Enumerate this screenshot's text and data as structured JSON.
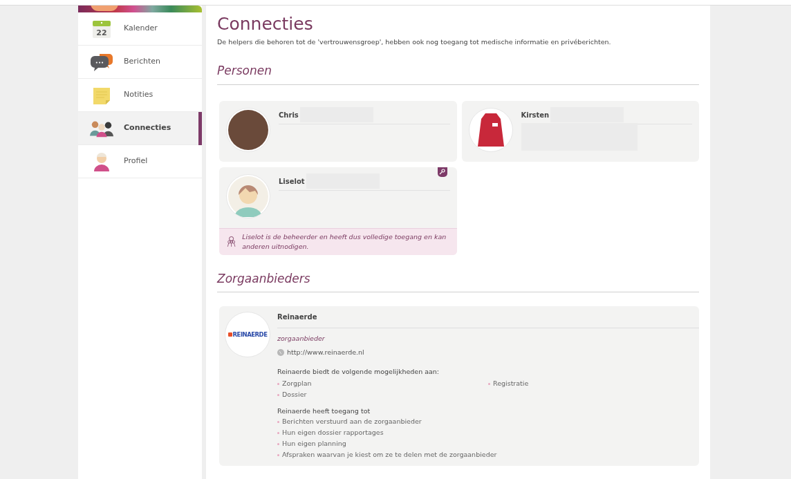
{
  "sidebar": {
    "items": [
      {
        "label": "Kalender",
        "kind": "calendar",
        "icon_text": "22",
        "selected": false
      },
      {
        "label": "Berichten",
        "kind": "chat",
        "icon_text": "•••",
        "selected": false
      },
      {
        "label": "Notities",
        "kind": "note",
        "selected": false
      },
      {
        "label": "Connecties",
        "kind": "people",
        "selected": true
      },
      {
        "label": "Profiel",
        "kind": "person",
        "selected": false
      }
    ]
  },
  "page": {
    "title": "Connecties",
    "intro": "De helpers die behoren tot de 'vertrouwensgroep', hebben ook nog toegang tot medische informatie en privéberichten."
  },
  "persons": {
    "heading": "Personen",
    "cards": [
      {
        "name": "Chris",
        "kind": "photo",
        "admin": false
      },
      {
        "name": "Kirsten",
        "kind": "hoodie",
        "admin": false
      },
      {
        "name": "Liselot",
        "kind": "illustration",
        "admin": true,
        "admin_note": "Liselot is de beheerder en heeft dus volledige toegang en kan anderen uitnodigen."
      }
    ]
  },
  "providers": {
    "heading": "Zorgaanbieders",
    "cards": [
      {
        "name": "Reinaerde",
        "logo_text": "REINAERDE",
        "type": "zorgaanbieder",
        "url": "http://www.reinaerde.nl",
        "offers_title": "Reinaerde biedt de volgende mogelijkheden aan:",
        "offers": [
          "Zorgplan",
          "Registratie",
          "Dossier"
        ],
        "access_title": "Reinaerde heeft toegang tot",
        "access": [
          "Berichten verstuurd aan de zorgaanbieder",
          "Hun eigen dossier rapportages",
          "Hun eigen planning",
          "Afspraken waarvan je kiest om ze te delen met de zorgaanbieder"
        ]
      }
    ]
  }
}
